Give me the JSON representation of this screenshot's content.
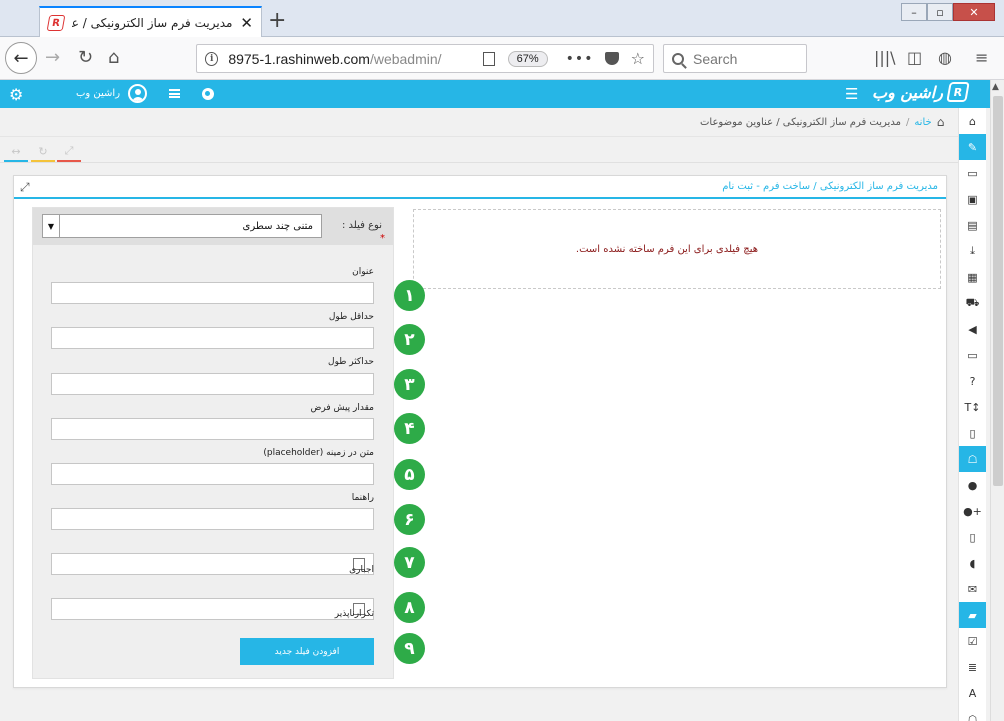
{
  "browser": {
    "tab_title": "مدیریت فرم ساز الکترونیکی / عناوین",
    "tab_favicon": "R",
    "url_main": "8975-1.rashinweb.com",
    "url_path": "/webadmin/",
    "zoom": "67%",
    "search_placeholder": "Search"
  },
  "header": {
    "user_name": "راشین وب",
    "brand": "راشین وب",
    "accent": "#26b6e6"
  },
  "breadcrumb": {
    "home": "خانه",
    "current": "مدیریت فرم ساز الکترونیکی / عناوین موضوعات"
  },
  "panel": {
    "title": "مدیریت فرم ساز الکترونیکی / ساخت فرم - ثبت نام",
    "empty_message": "هیچ فیلدی برای این فرم ساخته نشده است."
  },
  "form": {
    "field_type_label": "نوع فیلد :",
    "required_mark": "*",
    "field_type_value": "متنی چند سطری",
    "fields": [
      {
        "label": "عنوان",
        "step": "۱"
      },
      {
        "label": "حداقل طول",
        "step": "۲"
      },
      {
        "label": "حداکثر طول",
        "step": "۳"
      },
      {
        "label": "مقدار پیش فرض",
        "step": "۴"
      },
      {
        "label": "متن در زمینه (placeholder)",
        "step": "۵"
      },
      {
        "label": "راهنما",
        "step": "۶"
      }
    ],
    "checkboxes": [
      {
        "label": "اجباری",
        "step": "۷",
        "checked": false
      },
      {
        "label": "تکرارناپذیر",
        "step": "۸",
        "checked": false
      }
    ],
    "submit_label": "افزودن فیلد جدید",
    "submit_step": "۹",
    "step_color": "#2eab48"
  },
  "sidebar_icons": [
    "home-icon",
    "pencil-icon",
    "id-card-icon",
    "image-icon",
    "file-icon",
    "download-icon",
    "film-icon",
    "cart-icon",
    "volume-icon",
    "monitor-icon",
    "question-icon",
    "text-height-icon",
    "file-outline-icon",
    "inbox-icon",
    "user-icon",
    "user-add-icon",
    "mobile-icon",
    "comments-icon",
    "envelope-icon",
    "folder-open-icon",
    "check-square-icon",
    "list-icon",
    "font-icon",
    "inbox-2-icon"
  ]
}
